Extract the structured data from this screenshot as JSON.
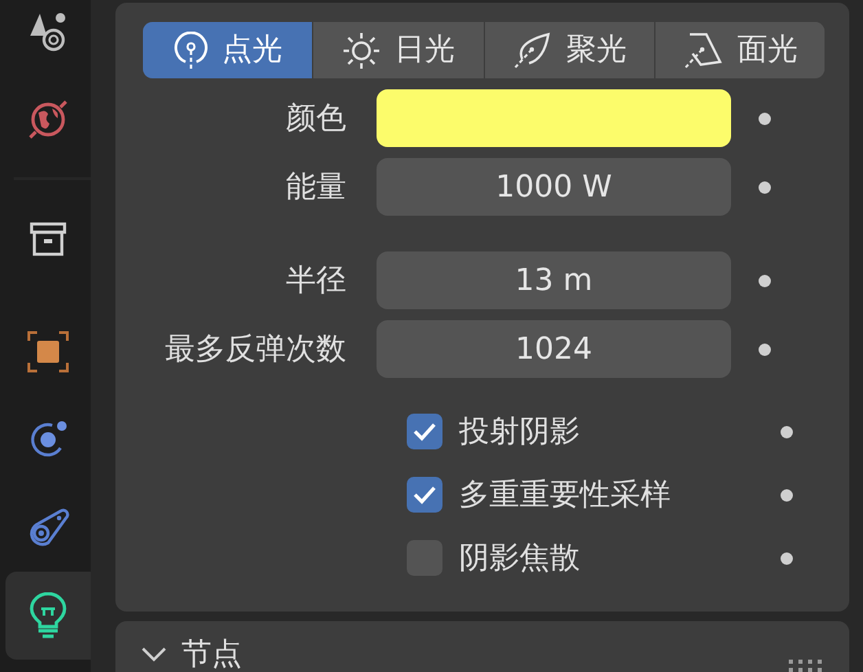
{
  "sidebar": {
    "tabs": [
      {
        "kind": "scene",
        "selected": false
      },
      {
        "kind": "world",
        "selected": false
      },
      {
        "kind": "collection",
        "selected": false
      },
      {
        "kind": "object",
        "selected": false
      },
      {
        "kind": "physics",
        "selected": false
      },
      {
        "kind": "constraints",
        "selected": false
      },
      {
        "kind": "light",
        "selected": true
      }
    ]
  },
  "light_types": [
    {
      "kind": "point",
      "label": "点光",
      "selected": true
    },
    {
      "kind": "sun",
      "label": "日光",
      "selected": false
    },
    {
      "kind": "spot",
      "label": "聚光",
      "selected": false
    },
    {
      "kind": "area",
      "label": "面光",
      "selected": false
    }
  ],
  "field_groups": [
    [
      {
        "kind": "color",
        "label": "颜色",
        "color": "#fcfc6b"
      },
      {
        "kind": "number",
        "label": "能量",
        "value": "1000 W"
      }
    ],
    [
      {
        "kind": "number",
        "label": "半径",
        "value": "13 m"
      },
      {
        "kind": "number",
        "label": "最多反弹次数",
        "value": "1024"
      }
    ]
  ],
  "checkboxes": [
    {
      "label": "投射阴影",
      "checked": true
    },
    {
      "label": "多重重要性采样",
      "checked": true
    },
    {
      "label": "阴影焦散",
      "checked": false
    }
  ],
  "subpanel": {
    "title": "节点",
    "expanded": true
  }
}
